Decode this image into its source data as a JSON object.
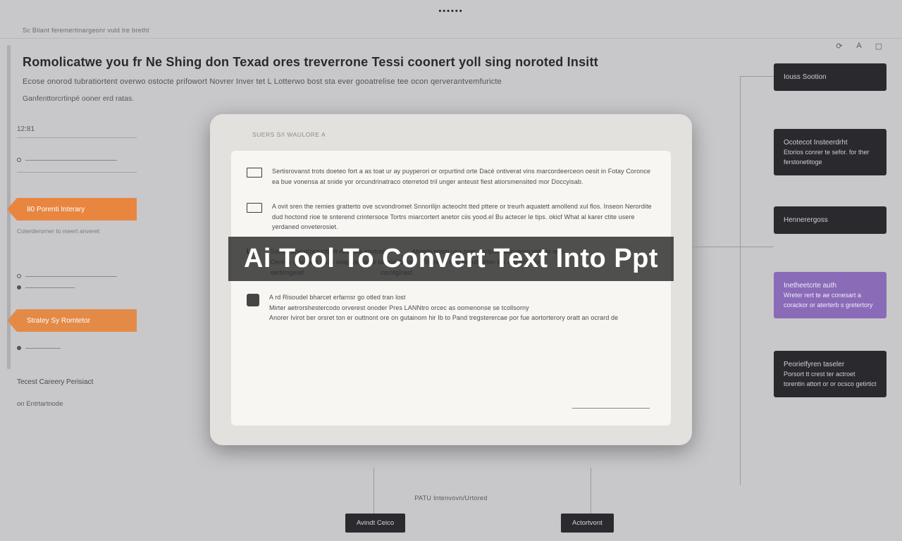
{
  "top": {
    "dots": "••••••",
    "breadcrumb": "Sc Bliant feremertinargeonr vuld tre bretht"
  },
  "header": {
    "title": "Romolicatwe you fr Ne Shing don Texad ores treverrone Tessi coonert yoll sing noroted Insitt",
    "subtitle1": "Ecose onorod tubratiortent overwo ostocte prifowort Novrer Inver tet L Lotterwo bost sta ever gooatrelise tee ocon qerverantvemfuricte",
    "subtitle2": "Ganfenttorcrtinpé ooner erd ratas."
  },
  "left": {
    "time_marker": "12:81",
    "tag1_label": "80 Porenti Interary",
    "tag1_sub": "Coterderorner to meert anveret",
    "tag2_label": "Stratey Sy Romtetor",
    "footer_label": "Tecest Careery Perisiact",
    "footer_sub": "on Entrtartnode"
  },
  "tablet": {
    "top_label": "SUERS S/I   WAULORE A",
    "sections": [
      {
        "icon": "rect",
        "text": "Sertisrovanst trots doeteo fort a as toat ur ay puyperori or orpurtind orte Dacé ontiverat vins marcordeerceon oesit in Fotay Coronce ea bue vonensa at snide yor orcundrinatraco oterretod tril unger anteust fiest atiorsmensited mor Doccyisab."
      },
      {
        "icon": "rect",
        "text": "A ovit sren the remies gratterto ove scvondromet Snnorilijn acteocht tted pttere or treurh aquatett amollend xul flos. Inseon Nerordite dud hoctond rioe te snterend crintersoce Tortrs miarcortert anetor ciis yood.el Bu actecer le tips. okicf What al karer ctite usere yerdaned onveterosiet."
      },
      {
        "icon": "lc",
        "lc_text": "LC",
        "text": "Somet ahentromortbort neceme anvtret's             Aboole stiom usa oner partpitr senoverco vets lo wes\nOerera ty romert rectti ooay vestatris ta oorintmom    Toress it ous becutovrton tok orp om wore.\noerfongeret.                                         corotginast"
      },
      {
        "icon": "badge",
        "text": "A rd Risoudel bharcet erfarnsr go otled tran lost\nMirter aetrorshestercodo orverest onoder Pres LANNtro orcec as oomenonse se tcollsorny\nAnorer Ivirot ber orsret ton er outtnont ore on gutainom hir Ib to Pand tregsterercae por fue aortorterory oratt an ocrard de"
      }
    ]
  },
  "right": {
    "cards": [
      {
        "title": "Iouss Sootion",
        "body": "",
        "style": "dark"
      },
      {
        "title": "Ocotecot Insteerdrht",
        "body": "Etorios conrer te sefor. for ther ferstonetitoge",
        "style": "dark"
      },
      {
        "title": "Hennerergoss",
        "body": "",
        "style": "dark"
      },
      {
        "title": "Inetheetcrte auth",
        "body": "Wreter rert te ae conesart a corackor or aterterb s gretertory",
        "style": "purple"
      },
      {
        "title": "Peorielfyren taseler",
        "body": "Porsort tt crest ter actroet torentin attort or or ocsco getirtict",
        "style": "dark"
      }
    ]
  },
  "bottom": {
    "center_label": "PATU Intenvovn/Urtored",
    "chip_left": "Avindt Ceico",
    "chip_right": "Actortvont"
  },
  "overlay": {
    "title": "Ai Tool To Convert Text Into Ppt"
  }
}
